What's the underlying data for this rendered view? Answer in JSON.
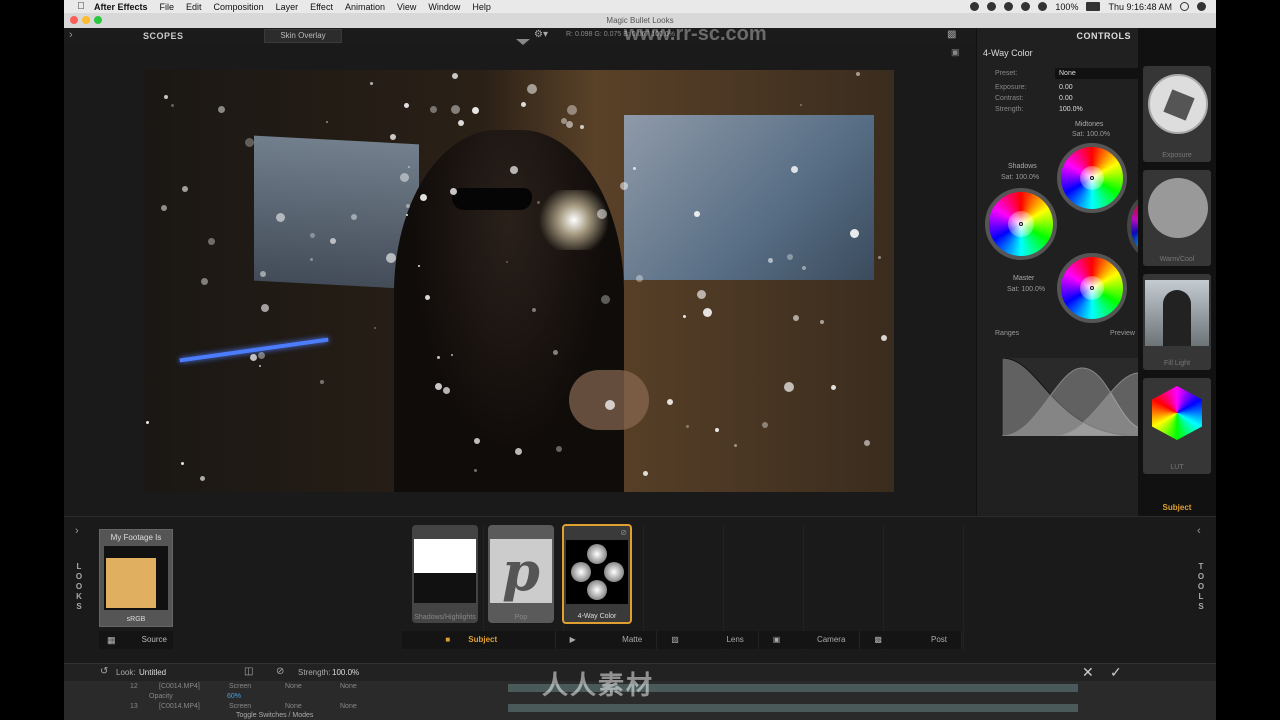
{
  "menubar": {
    "app": "After Effects",
    "items": [
      "File",
      "Edit",
      "Composition",
      "Layer",
      "Effect",
      "Animation",
      "View",
      "Window",
      "Help"
    ],
    "battery": "100%",
    "clock": "Thu 9:16:48 AM"
  },
  "window": {
    "title": "Magic Bullet Looks"
  },
  "scopes": {
    "title": "SCOPES",
    "skin_overlay": "Skin Overlay",
    "readout": "R: 0.098   G: 0.075   B: 0.067     100.0%"
  },
  "controls": {
    "title": "CONTROLS",
    "tool_name": "4-Way Color",
    "preset_label": "Preset:",
    "preset_value": "None",
    "exposure_label": "Exposure:",
    "exposure_value": "0.00",
    "contrast_label": "Contrast:",
    "contrast_value": "0.00",
    "strength_label": "Strength:",
    "strength_value": "100.0%",
    "midtones_label": "Midtones",
    "midtones_sat": "Sat: 100.0%",
    "shadows_label": "Shadows",
    "shadows_sat": "Sat: 100.0%",
    "master_label": "Master",
    "master_sat": "Sat: 100.0%",
    "ranges_label": "Ranges",
    "preview_label": "Preview"
  },
  "tools_strip": {
    "items": [
      "Exposure",
      "Warm/Cool",
      "Fill Light",
      "LUT"
    ],
    "category": "Subject"
  },
  "looks": {
    "left_label": [
      "L",
      "O",
      "O",
      "K",
      "S"
    ],
    "right_label": [
      "T",
      "O",
      "O",
      "L",
      "S"
    ],
    "source_card_title": "My Footage Is",
    "source_card_space": "sRGB",
    "source_label": "Source",
    "chain": [
      "Shadows/Highlights",
      "Pop",
      "4-Way Color"
    ],
    "categories": [
      "Subject",
      "Matte",
      "Lens",
      "Camera",
      "Post"
    ]
  },
  "status": {
    "look_label": "Look:",
    "look_name": "Untitled",
    "strength_label": "Strength:",
    "strength_value": "100.0%"
  },
  "timeline": {
    "row1_num": "12",
    "row1_name": "[C0014.MP4]",
    "row1_mode": "Screen",
    "row1_none": "None",
    "row1_none2": "None",
    "opacity_label": "Opacity",
    "opacity_value": "60%",
    "row2_num": "13",
    "row2_name": "[C0014.MP4]",
    "row2_mode": "Screen",
    "row2_none": "None",
    "row2_none2": "None",
    "toggle_label": "Toggle Switches / Modes"
  },
  "watermark": {
    "bottom": "人人素材",
    "top": "www.rr-sc.com"
  }
}
